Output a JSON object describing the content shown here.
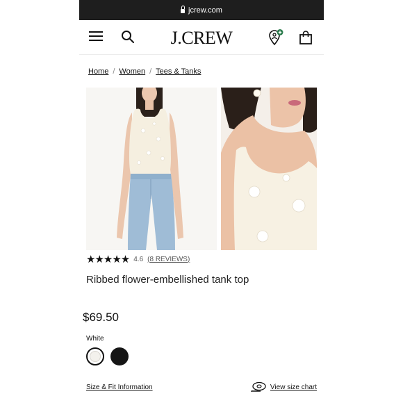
{
  "browser": {
    "url": "jcrew.com"
  },
  "header": {
    "logo": "J.CREW"
  },
  "breadcrumb": {
    "items": [
      "Home",
      "Women",
      "Tees & Tanks"
    ],
    "separator": "/"
  },
  "product": {
    "rating_stars": "★★★★★",
    "rating_value": "4.6",
    "reviews_label": "(8 REVIEWS)",
    "title": "Ribbed flower-embellished tank top",
    "price": "$69.50",
    "color_label": "White",
    "swatches": [
      "white",
      "black"
    ]
  },
  "links": {
    "size_fit": "Size & Fit Information",
    "size_chart": "View size chart"
  },
  "colors": {
    "header_bar": "#1e1e1e",
    "location_badge": "#2e7d4f",
    "text": "#111111"
  },
  "icons": [
    "lock-icon",
    "menu-icon",
    "search-icon",
    "location-icon",
    "bag-icon",
    "tape-measure-icon"
  ]
}
